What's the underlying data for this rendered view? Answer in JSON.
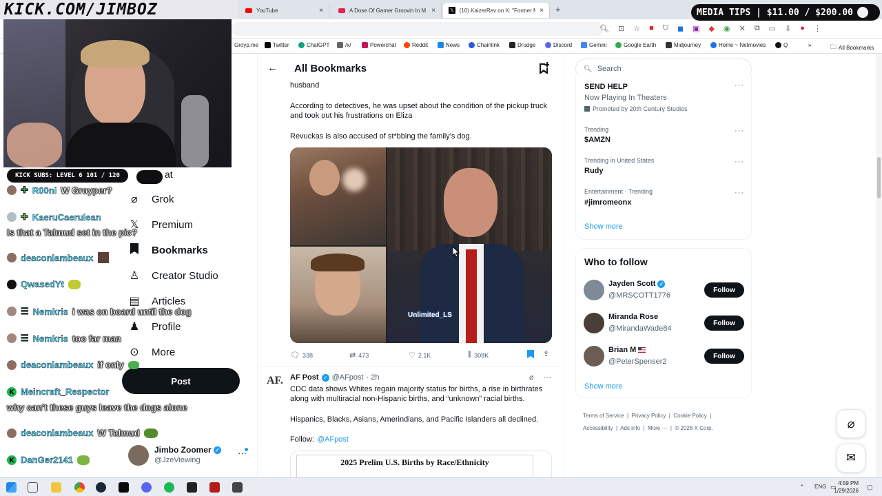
{
  "overlay": {
    "channel_banner": "KICK.COM/JIMBOZ",
    "media_tips": "MEDIA TIPS | $11.00 / $200.00",
    "kick_subs": "KICK SUBS: LEVEL 6 101 / 120",
    "watermark": "Unlimited_LS"
  },
  "browser": {
    "tabs": [
      {
        "label": "YouTube",
        "color": "#ff0000"
      },
      {
        "label": "A Dose Of Gamer Groovin In M",
        "color": "#e6234a"
      },
      {
        "label": "(10) KaizerRev on X: \"Former M",
        "color": "#000000"
      }
    ],
    "new_tab": "+",
    "bookmarks": [
      {
        "label": "Groyp.me",
        "color": "#777777"
      },
      {
        "label": "Twitter",
        "color": "#000000"
      },
      {
        "label": "ChatGPT",
        "color": "#10a37f"
      },
      {
        "label": "/x/",
        "color": "#444444"
      },
      {
        "label": "Powerchat",
        "color": "#c2185b"
      },
      {
        "label": "Reddit",
        "color": "#ff4500"
      },
      {
        "label": "News",
        "color": "#1e88e5"
      },
      {
        "label": "Chainlink",
        "color": "#2a5ada"
      },
      {
        "label": "Drudge",
        "color": "#222222"
      },
      {
        "label": "Discord",
        "color": "#5865f2"
      },
      {
        "label": "Gemini",
        "color": "#4285f4"
      },
      {
        "label": "Google Earth",
        "color": "#34a853"
      },
      {
        "label": "Midjourney",
        "color": "#333333"
      },
      {
        "label": "Home ~ Netmovies",
        "color": "#1a73e8"
      },
      {
        "label": "Q",
        "color": "#111111"
      }
    ],
    "all_bookmarks": "All Bookmarks"
  },
  "sidebar": {
    "items": [
      {
        "label": "Grok",
        "icon": "grok-icon"
      },
      {
        "label": "Premium",
        "icon": "x-logo-icon"
      },
      {
        "label": "Bookmarks",
        "icon": "bookmark-icon"
      },
      {
        "label": "Creator Studio",
        "icon": "creator-icon"
      },
      {
        "label": "Articles",
        "icon": "articles-icon"
      },
      {
        "label": "Profile",
        "icon": "profile-icon"
      },
      {
        "label": "More",
        "icon": "more-icon"
      }
    ],
    "cut_label": "at",
    "post_button": "Post",
    "account": {
      "name": "Jimbo Zoomer",
      "handle": "@JzeViewing"
    }
  },
  "main": {
    "title": "All Bookmarks",
    "tweet1": {
      "text_top": "husband",
      "text_p1": "According to detectives, he was upset about the condition of the pickup truck and took out his frustrations on Eliza",
      "text_p2": "Revuckas is also accused of st*bbing the family's dog.",
      "replies": "338",
      "reposts": "473",
      "likes": "2.1K",
      "views": "308K"
    },
    "tweet2": {
      "name": "AF Post",
      "handle": "@AFpost",
      "time": "· 2h",
      "avatar_text": "AF.",
      "text_p1": "CDC data shows Whites regain majority status for births, a rise in birthrates along with multiracial non-Hispanic births, and “unknown” racial births.",
      "text_p2": "Hispanics, Blacks, Asians, Amerindians, and Pacific Islanders all declined.",
      "follow_label": "Follow:",
      "follow_handle": "@AFpost",
      "embed_title": "2025 Prelim U.S. Births by Race/Ethnicity"
    }
  },
  "right": {
    "search_placeholder": "Search",
    "promo": {
      "title": "SEND HELP",
      "subtitle": "Now Playing In Theaters",
      "promoted": "Promoted by 20th Century Studios"
    },
    "trends": [
      {
        "meta": "Trending",
        "title": "$AMZN"
      },
      {
        "meta": "Trending in United States",
        "title": "Rudy"
      },
      {
        "meta": "Entertainment · Trending",
        "title": "#jimromeonx"
      }
    ],
    "show_more": "Show more",
    "who_to_follow": "Who to follow",
    "follow": [
      {
        "name": "Jayden Scott",
        "handle": "@MRSCOTT1776",
        "verified": true
      },
      {
        "name": "Miranda Rose",
        "handle": "@MirandaWade84",
        "verified": false
      },
      {
        "name": "Brian M",
        "handle": "@PeterSpenser2",
        "verified": false
      }
    ],
    "follow_label": "Follow",
    "show_more_2": "Show more",
    "footer": [
      "Terms of Service",
      "Privacy Policy",
      "Cookie Policy",
      "Accessibility",
      "Ads info",
      "More ···",
      "© 2026 X Corp."
    ]
  },
  "chat": [
    {
      "name": "R00ni",
      "msg": "W Groyper?",
      "color": "#3aa35a"
    },
    {
      "name": "KaeruCaerulean",
      "msg": "",
      "color": "#6ab04c"
    },
    {
      "name": "",
      "msg": "Is that a Talmud set in the pic?",
      "color": "#000000"
    },
    {
      "name": "deaconlambeaux",
      "msg": "",
      "color": "#8d6e63"
    },
    {
      "name": "QwasedYt",
      "msg": "",
      "color": "#111111"
    },
    {
      "name": "Nemkris",
      "msg": "i was on board until the dog",
      "color": "#a1887f"
    },
    {
      "name": "Nemkris",
      "msg": "too far man",
      "color": "#a1887f"
    },
    {
      "name": "deaconlambeaux",
      "msg": "if only",
      "color": "#8d6e63"
    },
    {
      "name": "Meincraft_Respector",
      "msg": "",
      "color": "#1db954"
    },
    {
      "name": "",
      "msg": "why can't these guys leave the dogs alone",
      "color": "#000000"
    },
    {
      "name": "deaconlambeaux",
      "msg": "W Talmud",
      "color": "#8d6e63"
    },
    {
      "name": "DanGer2141",
      "msg": "",
      "color": "#1db954"
    }
  ],
  "taskbar": {
    "lang": "ENG",
    "time": "4:59 PM",
    "date": "1/29/2026"
  }
}
